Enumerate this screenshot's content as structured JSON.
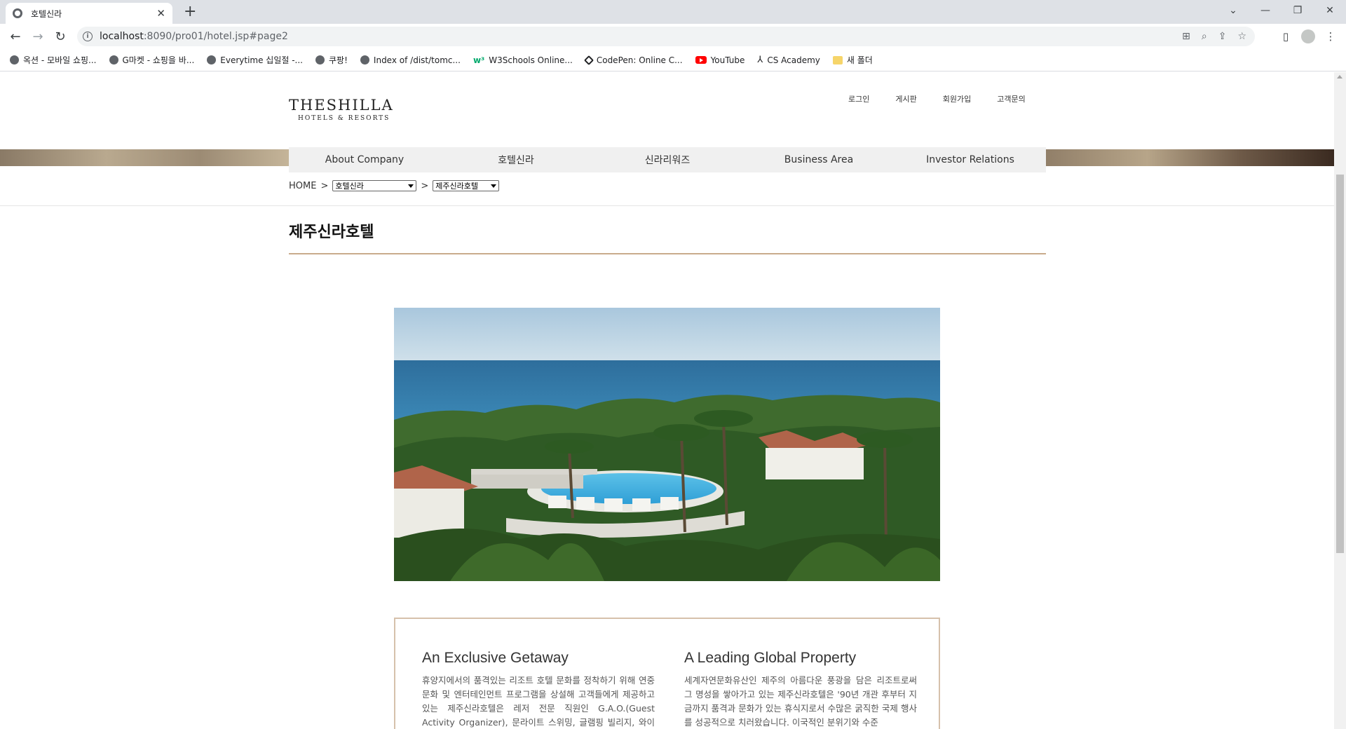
{
  "browser": {
    "tab_title": "호텔신라",
    "url_host": "localhost",
    "url_rest": ":8090/pro01/hotel.jsp#page2",
    "bookmarks": [
      {
        "label": "옥션 - 모바일 쇼핑...",
        "icon": "globe-icon"
      },
      {
        "label": "G마켓 - 쇼핑을 바...",
        "icon": "globe-icon"
      },
      {
        "label": "Everytime 십일절 -...",
        "icon": "globe-icon"
      },
      {
        "label": "쿠팡!",
        "icon": "globe-icon"
      },
      {
        "label": "Index of /dist/tomc...",
        "icon": "globe-icon"
      },
      {
        "label": "W3Schools Online...",
        "icon": "w3schools-icon"
      },
      {
        "label": "CodePen: Online C...",
        "icon": "codepen-icon"
      },
      {
        "label": "YouTube",
        "icon": "youtube-icon"
      },
      {
        "label": "CS Academy",
        "icon": "cs-academy-icon"
      },
      {
        "label": "새 폴더",
        "icon": "folder-icon"
      }
    ]
  },
  "site": {
    "logo_line1": "THESHILLA",
    "logo_line2": "HOTELS & RESORTS",
    "util_nav": [
      "로그인",
      "게시판",
      "회원가입",
      "고객문의"
    ],
    "gnb": [
      "About Company",
      "호텔신라",
      "신라리워즈",
      "Business Area",
      "Investor Relations"
    ],
    "breadcrumb": {
      "home": "HOME",
      "separator": ">",
      "select1": "호텔신라",
      "select2": "제주신라호텔"
    },
    "page_title": "제주신라호텔",
    "photo_alt": "Jeju Shilla Hotel pool and ocean view",
    "columns": [
      {
        "heading": "An Exclusive Getaway",
        "text": "휴양지에서의 품격있는 리조트 호텔 문화를 정착하기 위해 연중 문화 및 엔터테인먼트 프로그램을 상설해 고객들에게 제공하고 있는 제주신라호텔은 레저 전문 직원인 G.A.O.(Guest Activity Organizer), 문라이트 스위밍, 글램핑 빌리지, 와이너리 등"
      },
      {
        "heading": "A Leading Global Property",
        "text": "세계자연문화유산인 제주의 아름다운 풍광을 담은 리조트로써 그 명성을 쌓아가고 있는 제주신라호텔은 '90년 개관 후부터 지금까지 품격과 문화가 있는 휴식지로서 수많은 굵직한 국제 행사를 성공적으로 치러왔습니다. 이국적인 분위기와 수준"
      }
    ]
  },
  "colors": {
    "accent_gold": "#c9ab8c",
    "gnb_bg": "#f0f0f0"
  }
}
